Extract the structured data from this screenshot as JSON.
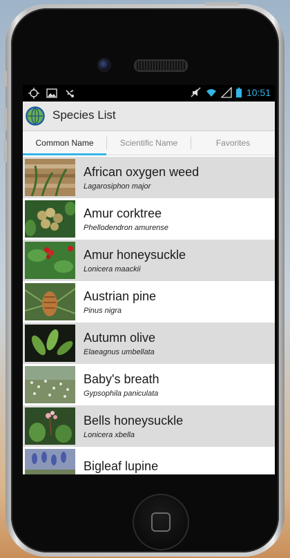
{
  "status_bar": {
    "left_icons": [
      "location-target-icon",
      "image-icon",
      "usb-debug-icon"
    ],
    "right_icons": [
      "mute-icon",
      "wifi-icon",
      "signal-icon",
      "battery-icon"
    ],
    "time": "10:51",
    "accent": "#33b5e5"
  },
  "app": {
    "title": "Species List",
    "logo_icon": "globe-icon"
  },
  "tabs": [
    {
      "label": "Common Name",
      "active": true
    },
    {
      "label": "Scientific Name",
      "active": false
    },
    {
      "label": "Favorites",
      "active": false
    }
  ],
  "species": [
    {
      "common": "African oxygen weed",
      "scientific": "Lagarosiphon major",
      "image": "photo-oxygen-weed"
    },
    {
      "common": "Amur corktree",
      "scientific": "Phellodendron amurense",
      "image": "photo-corktree"
    },
    {
      "common": "Amur honeysuckle",
      "scientific": "Lonicera maackii",
      "image": "photo-honeysuckle"
    },
    {
      "common": "Austrian pine",
      "scientific": "Pinus nigra",
      "image": "photo-pine"
    },
    {
      "common": "Autumn olive",
      "scientific": "Elaeagnus umbellata",
      "image": "photo-olive"
    },
    {
      "common": "Baby's breath",
      "scientific": "Gypsophila paniculata",
      "image": "photo-babys-breath"
    },
    {
      "common": "Bells honeysuckle",
      "scientific": "Lonicera xbella",
      "image": "photo-bells-honeysuckle"
    },
    {
      "common": "Bigleaf lupine",
      "scientific": "",
      "image": "photo-lupine"
    }
  ],
  "colors": {
    "alt_row": "#dcdcdc",
    "tab_indicator": "#33b5e5"
  }
}
